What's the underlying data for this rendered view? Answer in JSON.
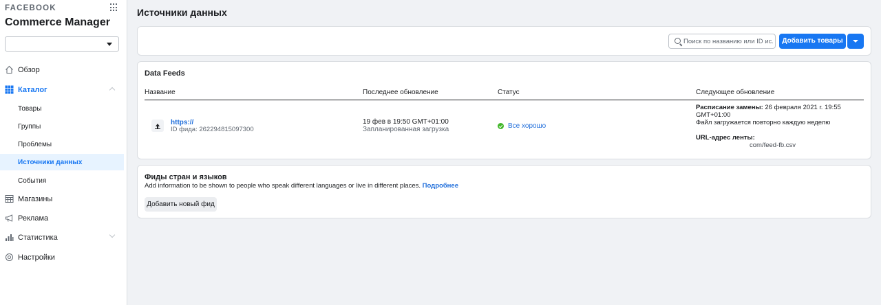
{
  "sidebar": {
    "brand": "FACEBOOK",
    "app_title": "Commerce Manager",
    "account_select_value": "",
    "nav": {
      "overview": "Обзор",
      "catalog": "Каталог",
      "catalog_sub": {
        "products": "Товары",
        "groups": "Группы",
        "problems": "Проблемы",
        "data_sources": "Источники данных",
        "events": "События"
      },
      "shops": "Магазины",
      "ads": "Реклама",
      "stats": "Статистика",
      "settings": "Настройки"
    },
    "accent_color": "#1877f2"
  },
  "main": {
    "page_title": "Источники данных",
    "toolbar": {
      "search_placeholder": "Поиск по названию или ID ис...",
      "add_products_label": "Добавить товары"
    },
    "data_feeds": {
      "title": "Data Feeds",
      "columns": {
        "name": "Название",
        "last_update": "Последнее обновление",
        "status": "Статус",
        "next_update": "Следующее обновление"
      },
      "row": {
        "name": "https://",
        "feed_id": "ID фида: 262294815097300",
        "last_update_time": "19 фев в 19:50 GMT+01:00",
        "last_update_type": "Запланированная загрузка",
        "status": "Все хорошо",
        "status_color": "#42b72a",
        "schedule_label": "Расписание замены:",
        "schedule_value_line1": "26 февраля 2021 г. 19:55",
        "schedule_value_line2": "GMT+01:00",
        "schedule_note": "Файл загружается повторно каждую неделю",
        "url_label": "URL-адрес ленты:",
        "url_value": "com/feed-fb.csv"
      }
    },
    "language_feeds": {
      "title": "Фиды стран и языков",
      "description": "Add information to be shown to people who speak different languages or live in different places.",
      "learn_more": "Подробнее",
      "add_button": "Добавить новый фид"
    }
  }
}
